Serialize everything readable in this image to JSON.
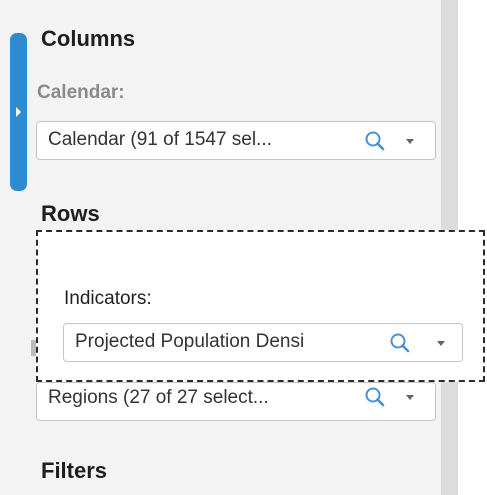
{
  "columns": {
    "title": "Columns",
    "calendar_label": "Calendar:",
    "calendar_value": "Calendar (91 of 1547 sel..."
  },
  "rows": {
    "title": "Rows",
    "regions_value": "Regions (27 of 27 select..."
  },
  "drag_overlay": {
    "label": "Indicators:",
    "value": "Projected Population Densi"
  },
  "filters": {
    "title": "Filters"
  },
  "colors": {
    "accent": "#2e8bd0",
    "panel_bg": "#f3f3f3",
    "search_icon": "#4a90d9"
  },
  "icons": [
    "search-icon",
    "caret-down-icon",
    "expand-arrow-icon"
  ]
}
